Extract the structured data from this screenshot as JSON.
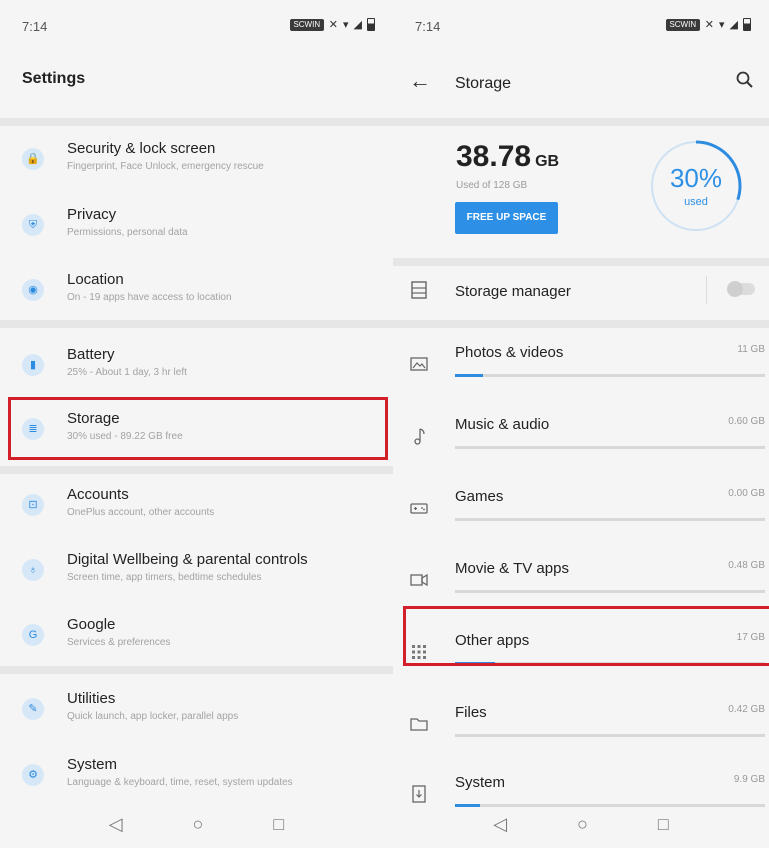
{
  "left": {
    "status_time": "7:14",
    "status_pill": "SCWIN",
    "title": "Settings",
    "items": [
      {
        "title": "Security & lock screen",
        "subtitle": "Fingerprint, Face Unlock, emergency rescue",
        "icon": "lock-icon",
        "glyph": "🔒"
      },
      {
        "title": "Privacy",
        "subtitle": "Permissions, personal data",
        "icon": "shield-icon",
        "glyph": "⛨"
      },
      {
        "title": "Location",
        "subtitle": "On - 19 apps have access to location",
        "icon": "location-icon",
        "glyph": "◉"
      },
      {
        "title": "Battery",
        "subtitle": "25% - About 1 day, 3 hr left",
        "icon": "battery-icon",
        "glyph": "▮"
      },
      {
        "title": "Storage",
        "subtitle": "30% used - 89.22 GB free",
        "icon": "storage-icon",
        "glyph": "≣"
      },
      {
        "title": "Accounts",
        "subtitle": "OnePlus account, other accounts",
        "icon": "account-icon",
        "glyph": "⊡"
      },
      {
        "title": "Digital Wellbeing & parental controls",
        "subtitle": "Screen time, app timers, bedtime schedules",
        "icon": "wellbeing-icon",
        "glyph": "♁"
      },
      {
        "title": "Google",
        "subtitle": "Services & preferences",
        "icon": "google-icon",
        "glyph": "G"
      },
      {
        "title": "Utilities",
        "subtitle": "Quick launch, app locker, parallel apps",
        "icon": "utilities-icon",
        "glyph": "✎"
      },
      {
        "title": "System",
        "subtitle": "Language & keyboard, time, reset, system updates",
        "icon": "system-icon",
        "glyph": "⚙"
      }
    ]
  },
  "right": {
    "status_time": "7:14",
    "status_pill": "SCWIN",
    "title": "Storage",
    "used_value": "38.78",
    "used_unit": "GB",
    "used_of": "Used of 128 GB",
    "free_up_label": "FREE UP SPACE",
    "ring_percent": "30%",
    "ring_label": "used",
    "ring_fraction": 0.3,
    "storage_manager_label": "Storage manager",
    "storage_manager_enabled": false,
    "categories": [
      {
        "name": "Photos & videos",
        "size": "11 GB",
        "fraction": 0.09,
        "icon": "image-icon"
      },
      {
        "name": "Music & audio",
        "size": "0.60 GB",
        "fraction": 0.0,
        "icon": "music-note-icon"
      },
      {
        "name": "Games",
        "size": "0.00 GB",
        "fraction": 0.0,
        "icon": "gamepad-icon"
      },
      {
        "name": "Movie & TV apps",
        "size": "0.48 GB",
        "fraction": 0.0,
        "icon": "video-camera-icon"
      },
      {
        "name": "Other apps",
        "size": "17 GB",
        "fraction": 0.13,
        "icon": "apps-grid-icon"
      },
      {
        "name": "Files",
        "size": "0.42 GB",
        "fraction": 0.0,
        "icon": "folder-icon"
      },
      {
        "name": "System",
        "size": "9.9 GB",
        "fraction": 0.08,
        "icon": "system-file-icon"
      }
    ]
  },
  "colors": {
    "accent": "#2d8ce0",
    "highlight": "#d21f2a"
  }
}
